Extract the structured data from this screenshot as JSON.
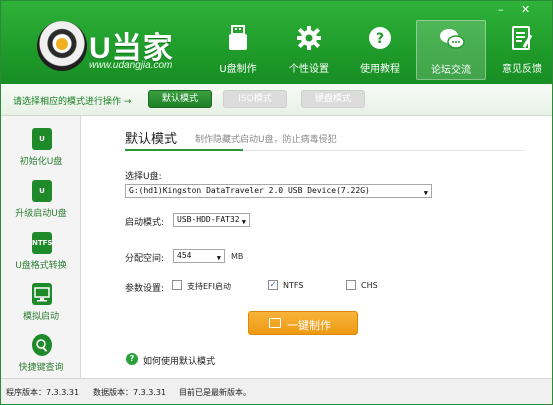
{
  "app": {
    "title": "U当家",
    "url": "www.udangjia.com",
    "window_controls": {
      "minimize": "–",
      "close": "✕"
    }
  },
  "nav": {
    "items": [
      {
        "label": "U盘制作",
        "icon": "usb-drive-icon",
        "active": false
      },
      {
        "label": "个性设置",
        "icon": "gear-icon",
        "active": false
      },
      {
        "label": "使用教程",
        "icon": "help-circle-icon",
        "active": false
      },
      {
        "label": "论坛交流",
        "icon": "chat-bubbles-icon",
        "active": true
      },
      {
        "label": "意见反馈",
        "icon": "feedback-form-icon",
        "active": false
      }
    ]
  },
  "mode_bar": {
    "hint": "请选择相应的模式进行操作 →",
    "buttons": [
      {
        "label": "默认模式",
        "selected": true
      },
      {
        "label": "ISO模式",
        "selected": false
      },
      {
        "label": "硬盘模式",
        "selected": false
      }
    ]
  },
  "sidebar": {
    "items": [
      {
        "label": "初始化U盘",
        "icon": "init-usb-icon",
        "icon_text": "U"
      },
      {
        "label": "升级启动U盘",
        "icon": "upgrade-usb-icon",
        "icon_text": "U"
      },
      {
        "label": "U盘格式转换",
        "icon": "ntfs-convert-icon",
        "icon_text": "NTFS"
      },
      {
        "label": "模拟启动",
        "icon": "monitor-icon",
        "icon_text": ""
      },
      {
        "label": "快捷键查询",
        "icon": "search-key-icon",
        "icon_text": ""
      }
    ]
  },
  "main": {
    "title": "默认模式",
    "subtitle": "制作隐藏式启动U盘，防止病毒侵犯",
    "select_disk_label": "选择U盘:",
    "disk_value": "G:(hd1)Kingston DataTraveler 2.0 USB Device(7.22G)",
    "boot_mode_label": "启动模式:",
    "boot_mode_value": "USB-HDD-FAT32",
    "alloc_label": "分配空间:",
    "alloc_value": "454",
    "alloc_unit": "MB",
    "params_label": "参数设置:",
    "options": [
      {
        "label": "支持EFI启动",
        "checked": false
      },
      {
        "label": "NTFS",
        "checked": true
      },
      {
        "label": "CHS",
        "checked": false
      }
    ],
    "make_button": "一键制作",
    "help_link": "如何使用默认模式"
  },
  "status": {
    "program_version": "程序版本：7.3.3.31",
    "data_version": "数据版本：7.3.3.31",
    "latest_note": "目前已是最新版本。"
  },
  "colors": {
    "brand_green": "#1f9b2a",
    "accent_orange": "#ee9a12"
  }
}
